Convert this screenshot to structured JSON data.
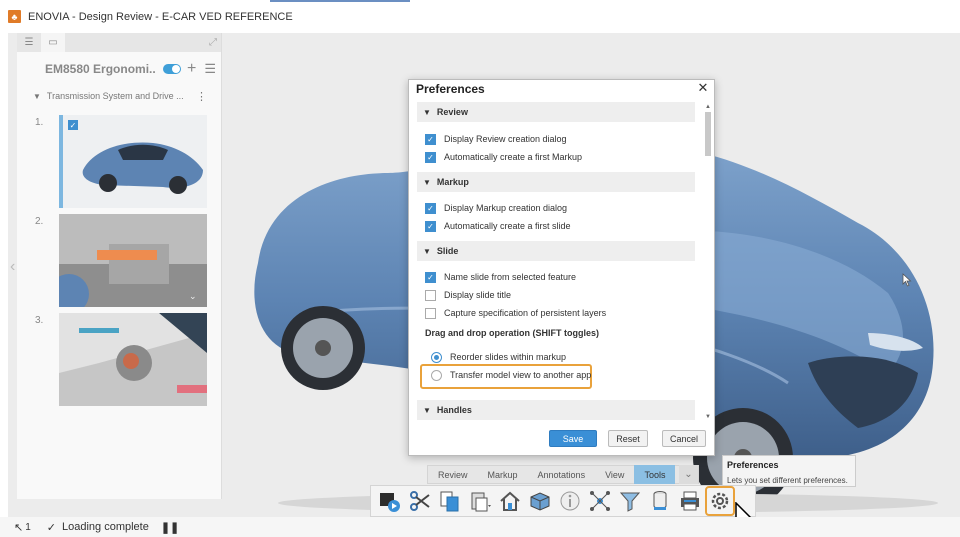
{
  "window": {
    "title": "ENOVIA - Design Review - E-CAR VED REFERENCE",
    "logo_glyph": "3DS"
  },
  "sidepanel": {
    "review_title": "EM8580 Ergonomi...",
    "section_title": "Transmission System and Drive ...",
    "slides": [
      {
        "number": "1."
      },
      {
        "number": "2."
      },
      {
        "number": "3."
      }
    ]
  },
  "dialog": {
    "title": "Preferences",
    "sections": {
      "review": "Review",
      "markup": "Markup",
      "slide": "Slide",
      "handles": "Handles"
    },
    "options": {
      "display_review_creation": "Display Review creation dialog",
      "auto_first_markup": "Automatically create a first Markup",
      "display_markup_creation": "Display Markup creation dialog",
      "auto_first_slide": "Automatically create a first slide",
      "name_slide": "Name slide from selected feature",
      "display_slide_title": "Display slide title",
      "capture_layers": "Capture specification of persistent layers"
    },
    "drag_label": "Drag and drop operation (SHIFT toggles)",
    "radios": {
      "reorder": "Reorder slides within markup",
      "transfer": "Transfer model view to another app"
    },
    "buttons": {
      "save": "Save",
      "reset": "Reset",
      "cancel": "Cancel"
    }
  },
  "toolbar": {
    "tabs": [
      "Review",
      "Markup",
      "Annotations",
      "View",
      "Tools"
    ],
    "active_tab": "Tools"
  },
  "tooltip": {
    "title": "Preferences",
    "description": "Lets you set different preferences."
  },
  "status": {
    "selection_count": "1",
    "message": "Loading complete"
  },
  "colors": {
    "accent_blue": "#3a8fd6",
    "highlight_orange": "#e9a23b",
    "car_blue": "#5d84b3"
  }
}
